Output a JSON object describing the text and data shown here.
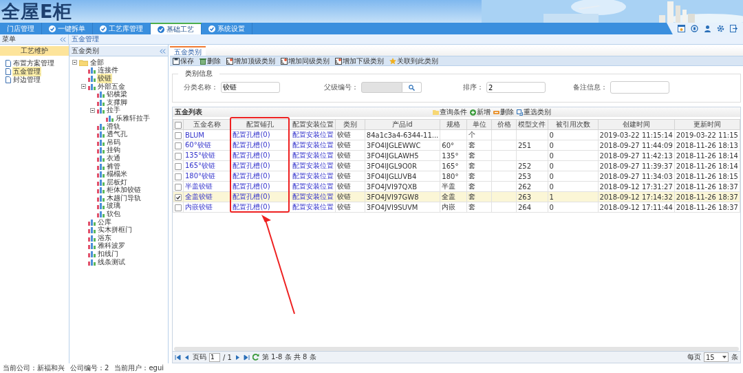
{
  "logo": {
    "text": "全屋E柜"
  },
  "nav_tabs": [
    {
      "label": "门店管理",
      "selected": false
    },
    {
      "label": "一键拆单",
      "selected": false
    },
    {
      "label": "工艺库管理",
      "selected": false
    },
    {
      "label": "基础工艺",
      "selected": true
    },
    {
      "label": "系统设置",
      "selected": false
    }
  ],
  "menu_header": {
    "title": "菜单",
    "breadcrumb": "五金管理"
  },
  "sidebar": {
    "title": "工艺维护",
    "items": [
      {
        "label": "布置方案管理",
        "selected": false
      },
      {
        "label": "五金管理",
        "selected": true
      },
      {
        "label": "封边管理",
        "selected": false
      }
    ]
  },
  "category_panel": {
    "title": "五金类别",
    "tree": {
      "label": "全部",
      "expanded": true,
      "selected": false,
      "children": [
        {
          "label": "连接件",
          "selected": false
        },
        {
          "label": "铰链",
          "selected": true
        },
        {
          "label": "外部五金",
          "expanded": true,
          "selected": false,
          "children": [
            {
              "label": "铝横梁",
              "selected": false
            },
            {
              "label": "支撑脚",
              "selected": false
            },
            {
              "label": "拉手",
              "expanded": true,
              "selected": false,
              "children": [
                {
                  "label": "乐雅轩拉手",
                  "selected": false
                }
              ]
            },
            {
              "label": "滑轨",
              "selected": false
            },
            {
              "label": "透气孔",
              "selected": false
            },
            {
              "label": "吊码",
              "selected": false
            },
            {
              "label": "挂钩",
              "selected": false
            },
            {
              "label": "衣通",
              "selected": false
            },
            {
              "label": "裤管",
              "selected": false
            },
            {
              "label": "榻榻米",
              "selected": false
            },
            {
              "label": "层板灯",
              "selected": false
            },
            {
              "label": "柜体加铰链",
              "selected": false
            },
            {
              "label": "木趟门导轨",
              "selected": false
            },
            {
              "label": "玻璃",
              "selected": false
            },
            {
              "label": "软包",
              "selected": false
            }
          ]
        },
        {
          "label": "公库",
          "selected": false
        },
        {
          "label": "实木拼框门",
          "selected": false
        },
        {
          "label": "浴东",
          "selected": false
        },
        {
          "label": "雅科波罗",
          "selected": false
        },
        {
          "label": "扣线门",
          "selected": false
        },
        {
          "label": "线条测试",
          "selected": false
        }
      ]
    }
  },
  "content_tab": {
    "label": "五金类别"
  },
  "toolbar": [
    "保存",
    "删除",
    "增加顶级类别",
    "增加同级类别",
    "增加下级类别",
    "关联到此类别"
  ],
  "category_info": {
    "legend": "类别信息",
    "fields": [
      {
        "kind": "text",
        "label": "分类名称：",
        "value": "铰链"
      },
      {
        "kind": "lookup",
        "label": "父级编号：",
        "disabled": true
      },
      {
        "kind": "text",
        "label": "排序：",
        "value": "2"
      },
      {
        "kind": "textarea",
        "label": "备注信息："
      }
    ]
  },
  "list": {
    "title": "五金列表",
    "all_checked": false,
    "actions": [
      "查询条件",
      "新增",
      "删除",
      "重选类别"
    ],
    "columns": [
      "五金名称",
      "配置铺孔",
      "配置安装位置",
      "类别",
      "产品id",
      "规格",
      "单位",
      "价格",
      "模型文件",
      "被引用次数",
      "创建时间",
      "更新时间"
    ],
    "rows": [
      {
        "checked": false,
        "cells": [
          "BLUM",
          "配置孔槽(0)",
          "配置安装位置",
          "铰链",
          "84a1c3a4-6344-11...",
          "",
          "个",
          "",
          "",
          "0",
          "2019-03-22 11:15:14",
          "2019-03-22 11:15"
        ]
      },
      {
        "checked": false,
        "cells": [
          "60°铰链",
          "配置孔槽(0)",
          "配置安装位置",
          "铰链",
          "3FO4IJGLEWWC",
          "60°",
          "套",
          "",
          "251",
          "0",
          "2018-09-27 11:44:09",
          "2018-11-26 18:13"
        ]
      },
      {
        "checked": false,
        "cells": [
          "135°铰链",
          "配置孔槽(0)",
          "配置安装位置",
          "铰链",
          "3FO4IJGLAWH5",
          "135°",
          "套",
          "",
          "",
          "0",
          "2018-09-27 11:42:13",
          "2018-11-26 18:14"
        ]
      },
      {
        "checked": false,
        "cells": [
          "165°铰链",
          "配置孔槽(0)",
          "配置安装位置",
          "铰链",
          "3FO4IJGL9O0R",
          "165°",
          "套",
          "",
          "252",
          "0",
          "2018-09-27 11:39:37",
          "2018-11-26 18:14"
        ]
      },
      {
        "checked": false,
        "cells": [
          "180°铰链",
          "配置孔槽(0)",
          "配置安装位置",
          "铰链",
          "3FO4IJGLUVB4",
          "180°",
          "套",
          "",
          "253",
          "0",
          "2018-09-27 11:34:03",
          "2018-11-26 18:15"
        ]
      },
      {
        "checked": false,
        "cells": [
          "半盖铰链",
          "配置孔槽(0)",
          "配置安装位置",
          "铰链",
          "3FO4JVI97QXB",
          "半盖",
          "套",
          "",
          "262",
          "0",
          "2018-09-12 17:31:27",
          "2018-11-26 18:37"
        ]
      },
      {
        "checked": true,
        "cells": [
          "全盖铰链",
          "配置孔槽(0)",
          "配置安装位置",
          "铰链",
          "3FO4JVI97GW8",
          "全盖",
          "套",
          "",
          "263",
          "1",
          "2018-09-12 17:14:32",
          "2018-11-26 18:37"
        ]
      },
      {
        "checked": false,
        "cells": [
          "内嵌铰链",
          "配置孔槽(0)",
          "配置安装位置",
          "铰链",
          "3FO4JVI9SUVM",
          "内嵌",
          "套",
          "",
          "264",
          "0",
          "2018-09-12 17:11:44",
          "2018-11-26 18:37"
        ]
      }
    ]
  },
  "pagination": {
    "page_label": "页码",
    "page": "1",
    "total_pages": "/ 1",
    "summary": "第 1-8 条  共 8 条",
    "per_page_label": "每页",
    "per_page": "15",
    "unit": "条"
  },
  "status_bar": {
    "company_label": "当前公司：",
    "company": "新福和兴",
    "number_label": "公司编号：",
    "number": "2",
    "user_label": "当前用户：",
    "user": "egui"
  }
}
